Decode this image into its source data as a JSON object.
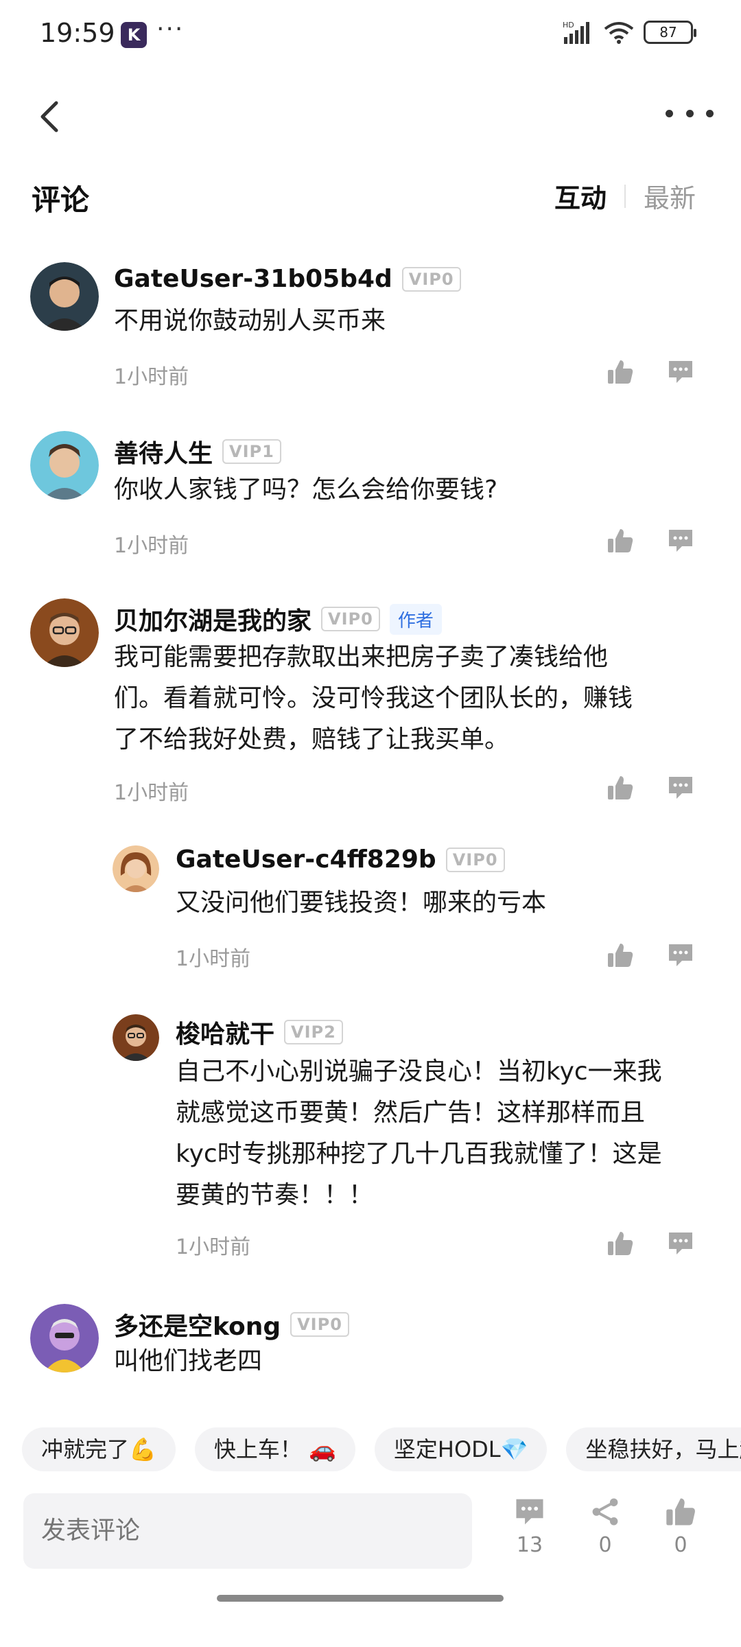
{
  "status": {
    "time": "19:59",
    "app_letter": "K",
    "more": "···",
    "battery": "87"
  },
  "header": {
    "title": "评论",
    "sort_active": "互动",
    "sort_inactive": "最新"
  },
  "comments": [
    {
      "user": "GateUser-31b05b4d",
      "vip": "VIP0",
      "text": "不用说你鼓动别人买币来",
      "time": "1小时前"
    },
    {
      "user": "善待人生",
      "vip": "VIP1",
      "text": "你收人家钱了吗？怎么会给你要钱?",
      "time": "1小时前"
    },
    {
      "user": "贝加尔湖是我的家",
      "vip": "VIP0",
      "badge": "作者",
      "lines": [
        "我可能需要把存款取出来把房子卖了凑钱给他",
        "们。看着就可怜。没可怜我这个团队长的，赚钱",
        "了不给我好处费，赔钱了让我买单。"
      ],
      "time": "1小时前"
    },
    {
      "user": "GateUser-c4ff829b",
      "vip": "VIP0",
      "text": "又没问他们要钱投资！哪来的亏本",
      "time": "1小时前"
    },
    {
      "user": "梭哈就干",
      "vip": "VIP2",
      "lines": [
        "自己不小心别说骗子没良心！当初kyc一来我",
        "就感觉这币要黄！然后广告！这样那样而且",
        "kyc时专挑那种挖了几十几百我就懂了！这是",
        "要黄的节奏！！！"
      ],
      "time": "1小时前"
    },
    {
      "user": "多还是空kong",
      "vip": "VIP0",
      "text": "叫他们找老四"
    }
  ],
  "chips": [
    "冲就完了💪",
    "快上车！ 🚗",
    "坚定HODL💎",
    "坐稳扶好，马上起"
  ],
  "bottom": {
    "input_placeholder": "发表评论",
    "comment_count": "13",
    "share_count": "0",
    "like_count": "0"
  },
  "colors": {
    "accent_blue": "#2f6fe0",
    "vip_gray": "#b7b7b7",
    "icon_gray": "#a9a9a9"
  }
}
